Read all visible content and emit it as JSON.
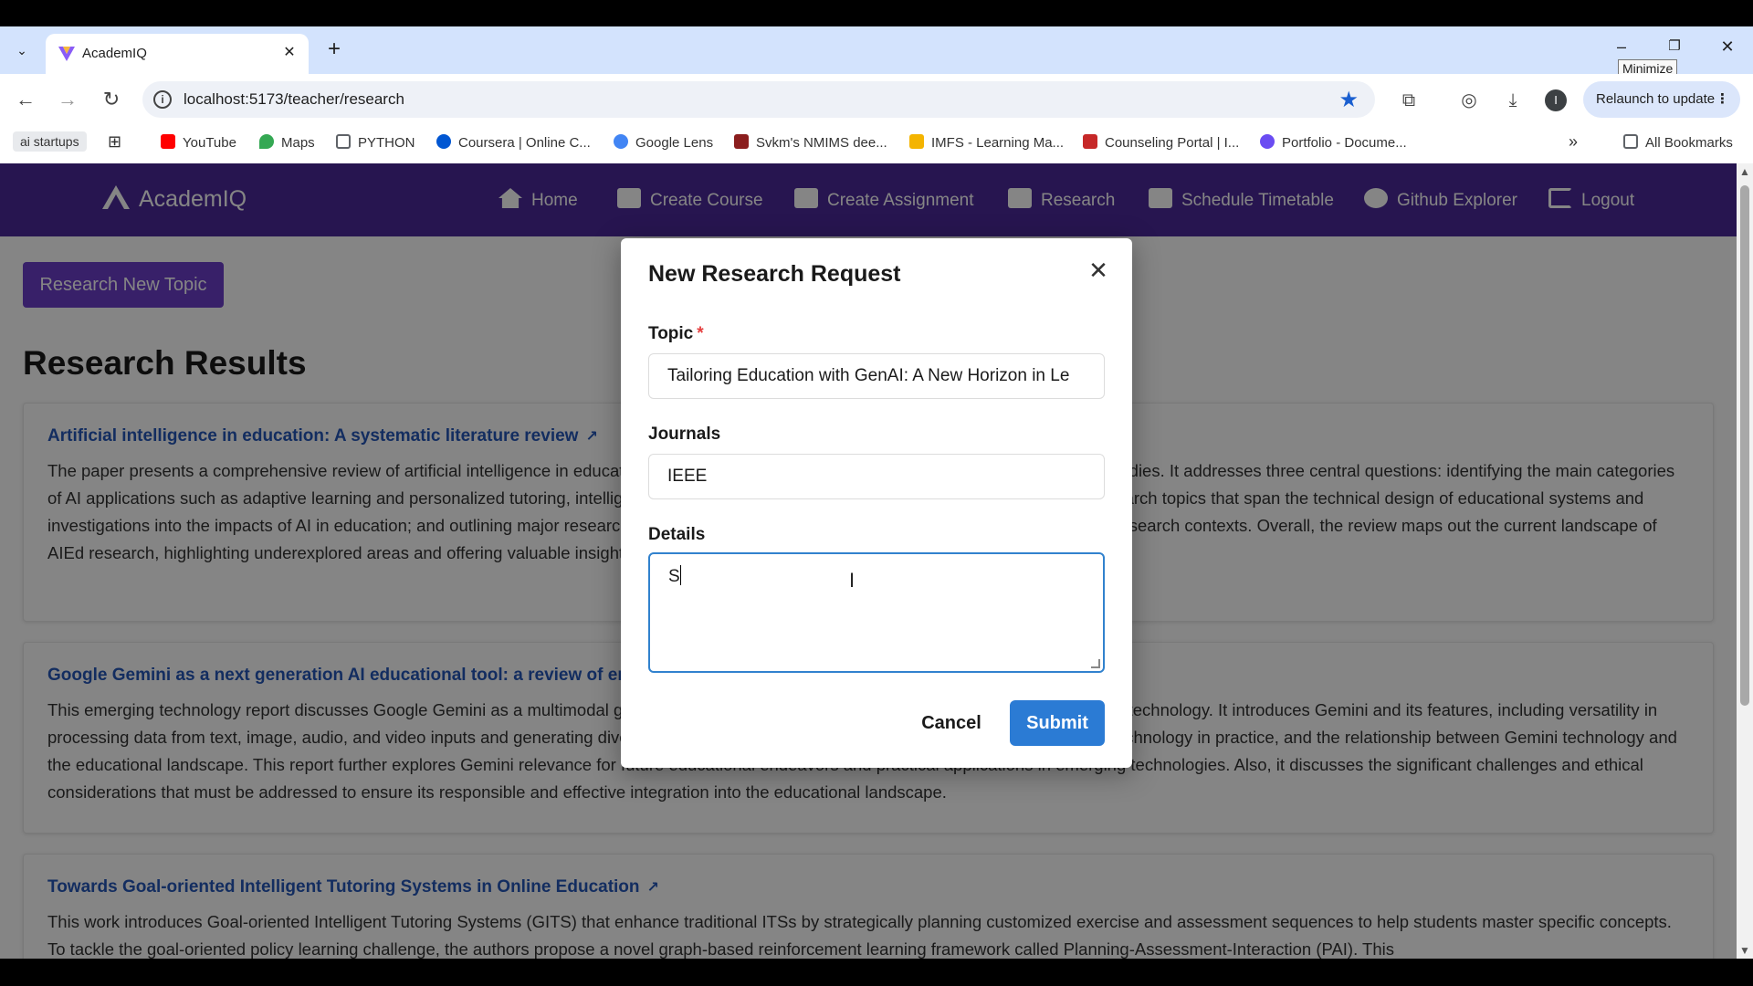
{
  "browser": {
    "tab_title": "AcademIQ",
    "url": "localhost:5173/teacher/research",
    "tooltip": "Minimize",
    "relaunch_label": "Relaunch to update",
    "profile_initial": "I",
    "bookmarks": [
      {
        "label": "ai startups"
      },
      {
        "label": "YouTube",
        "color": "#ff0000"
      },
      {
        "label": "Maps",
        "color": "#34a853"
      },
      {
        "label": "PYTHON",
        "color": "#5f6368"
      },
      {
        "label": "Coursera | Online C...",
        "color": "#0056d2"
      },
      {
        "label": "Google Lens",
        "color": "#4285f4"
      },
      {
        "label": "Svkm's NMIMS dee...",
        "color": "#8b1e1e"
      },
      {
        "label": "IMFS - Learning Ma...",
        "color": "#f4b400"
      },
      {
        "label": "Counseling Portal | I...",
        "color": "#c62828"
      },
      {
        "label": "Portfolio - Docume...",
        "color": "#6a4cf2"
      }
    ],
    "all_bookmarks": "All Bookmarks"
  },
  "app": {
    "brand": "AcademIQ",
    "nav": [
      "Home",
      "Create Course",
      "Create Assignment",
      "Research",
      "Schedule Timetable",
      "Github Explorer",
      "Logout"
    ],
    "new_topic_button": "Research New Topic",
    "results_heading": "Research Results",
    "results": [
      {
        "title": "Artificial intelligence in education: A systematic literature review",
        "body": "The paper presents a comprehensive review of artificial intelligence in education (AIEd) research, including a detailed examination of 125 key studies. It addresses three central questions: identifying the main categories of AI applications such as adaptive learning and personalized tutoring, intelligent assessment, and educational tools; exploring predominant research topics that span the technical design of educational systems and investigations into the impacts of AI in education; and outlining major research design elements including guiding theories, methodologies, and research contexts. Overall, the review maps out the current landscape of AIEd research, highlighting underexplored areas and offering valuable insights for future research in this dynamic field."
      },
      {
        "title": "Google Gemini as a next generation AI educational tool: a review of emerging educational technology",
        "body": "This emerging technology report discusses Google Gemini as a multimodal generative AI tool and its potential implications for future educational technology. It introduces Gemini and its features, including versatility in processing data from text, image, audio, and video inputs and generating diverse content types. The study discusses recent empirical studies, technology in practice, and the relationship between Gemini technology and the educational landscape. This report further explores Gemini relevance for future educational endeavors and practical applications in emerging technologies. Also, it discusses the significant challenges and ethical considerations that must be addressed to ensure its responsible and effective integration into the educational landscape."
      },
      {
        "title": "Towards Goal-oriented Intelligent Tutoring Systems in Online Education",
        "body": "This work introduces Goal-oriented Intelligent Tutoring Systems (GITS) that enhance traditional ITSs by strategically planning customized exercise and assessment sequences to help students master specific concepts. To tackle the goal-oriented policy learning challenge, the authors propose a novel graph-based reinforcement learning framework called Planning-Assessment-Interaction (PAI). This"
      }
    ]
  },
  "modal": {
    "title": "New Research Request",
    "topic_label": "Topic",
    "required_marker": "*",
    "topic_value": "Tailoring Education with GenAI: A New Horizon in Le",
    "journals_label": "Journals",
    "journals_value": "IEEE",
    "details_label": "Details",
    "details_value": "S",
    "cancel_label": "Cancel",
    "submit_label": "Submit"
  },
  "colors": {
    "appbar": "#4b2a9a",
    "primary_button": "#6b3fc9",
    "submit": "#2b7bd4",
    "link": "#2556b8"
  }
}
